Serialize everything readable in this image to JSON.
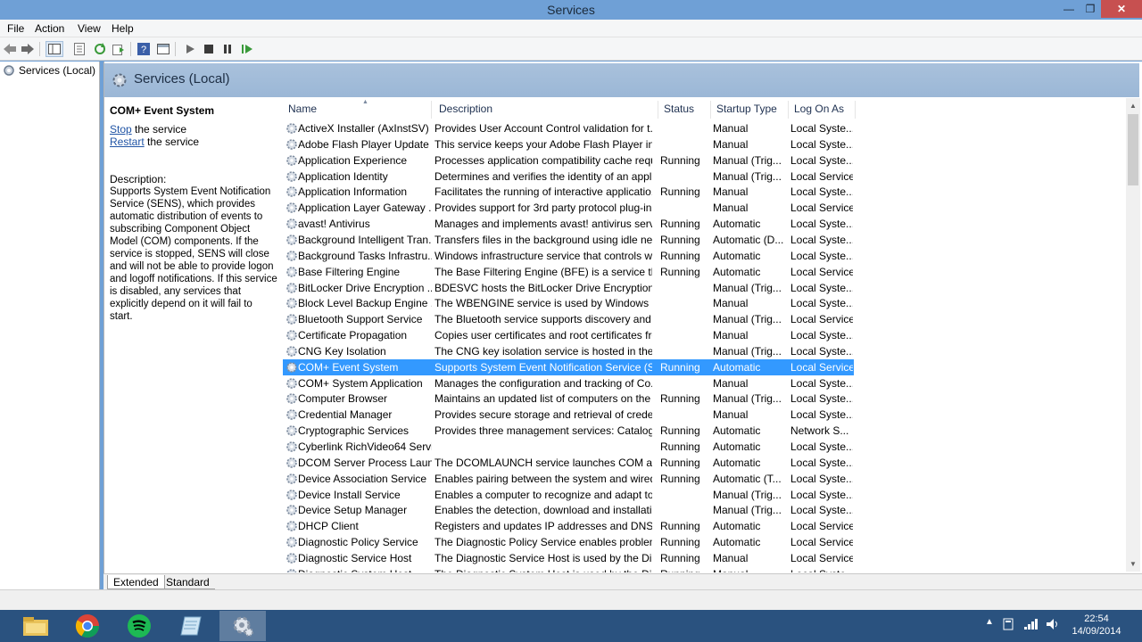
{
  "window": {
    "title": "Services",
    "controls": {
      "minimize": "—",
      "maximize": "❐",
      "close": "✕"
    }
  },
  "menu": [
    "File",
    "Action",
    "View",
    "Help"
  ],
  "toolbar": {
    "icons": [
      "back-icon",
      "forward-icon",
      "show-hide-tree-icon",
      "properties-icon",
      "refresh-icon",
      "export-list-icon",
      "help-icon",
      "view-icon",
      "play-icon",
      "stop-icon",
      "pause-icon",
      "resume-icon"
    ]
  },
  "tree": {
    "root": "Services (Local)"
  },
  "banner": {
    "title": "Services (Local)"
  },
  "details": {
    "service_title": "COM+ Event System",
    "stop_link": "Stop",
    "stop_suffix": " the service",
    "restart_link": "Restart",
    "restart_suffix": " the service",
    "description_label": "Description:",
    "description": "Supports System Event Notification Service (SENS), which provides automatic distribution of events to subscribing Component Object Model (COM) components. If the service is stopped, SENS will close and will not be able to provide logon and logoff notifications. If this service is disabled, any services that explicitly depend on it will fail to start."
  },
  "table": {
    "columns": [
      "Name",
      "Description",
      "Status",
      "Startup Type",
      "Log On As"
    ],
    "sort_indicator": "▲",
    "selected_index": 15,
    "rows": [
      [
        "ActiveX Installer (AxInstSV)",
        "Provides User Account Control validation for t...",
        "",
        "Manual",
        "Local Syste..."
      ],
      [
        "Adobe Flash Player Update ...",
        "This service keeps your Adobe Flash Player inst...",
        "",
        "Manual",
        "Local Syste..."
      ],
      [
        "Application Experience",
        "Processes application compatibility cache requ...",
        "Running",
        "Manual (Trig...",
        "Local Syste..."
      ],
      [
        "Application Identity",
        "Determines and verifies the identity of an appli...",
        "",
        "Manual (Trig...",
        "Local Service"
      ],
      [
        "Application Information",
        "Facilitates the running of interactive applicatio...",
        "Running",
        "Manual",
        "Local Syste..."
      ],
      [
        "Application Layer Gateway ...",
        "Provides support for 3rd party protocol plug-in...",
        "",
        "Manual",
        "Local Service"
      ],
      [
        "avast! Antivirus",
        "Manages and implements avast! antivirus servi...",
        "Running",
        "Automatic",
        "Local Syste..."
      ],
      [
        "Background Intelligent Tran...",
        "Transfers files in the background using idle net...",
        "Running",
        "Automatic (D...",
        "Local Syste..."
      ],
      [
        "Background Tasks Infrastru...",
        "Windows infrastructure service that controls w...",
        "Running",
        "Automatic",
        "Local Syste..."
      ],
      [
        "Base Filtering Engine",
        "The Base Filtering Engine (BFE) is a service that ...",
        "Running",
        "Automatic",
        "Local Service"
      ],
      [
        "BitLocker Drive Encryption ...",
        "BDESVC hosts the BitLocker Drive Encryption s...",
        "",
        "Manual (Trig...",
        "Local Syste..."
      ],
      [
        "Block Level Backup Engine ...",
        "The WBENGINE service is used by Windows Ba...",
        "",
        "Manual",
        "Local Syste..."
      ],
      [
        "Bluetooth Support Service",
        "The Bluetooth service supports discovery and a...",
        "",
        "Manual (Trig...",
        "Local Service"
      ],
      [
        "Certificate Propagation",
        "Copies user certificates and root certificates fro...",
        "",
        "Manual",
        "Local Syste..."
      ],
      [
        "CNG Key Isolation",
        "The CNG key isolation service is hosted in the L...",
        "",
        "Manual (Trig...",
        "Local Syste..."
      ],
      [
        "COM+ Event System",
        "Supports System Event Notification Service (SE...",
        "Running",
        "Automatic",
        "Local Service"
      ],
      [
        "COM+ System Application",
        "Manages the configuration and tracking of Co...",
        "",
        "Manual",
        "Local Syste..."
      ],
      [
        "Computer Browser",
        "Maintains an updated list of computers on the ...",
        "Running",
        "Manual (Trig...",
        "Local Syste..."
      ],
      [
        "Credential Manager",
        "Provides secure storage and retrieval of creden...",
        "",
        "Manual",
        "Local Syste..."
      ],
      [
        "Cryptographic Services",
        "Provides three management services: Catalog ...",
        "Running",
        "Automatic",
        "Network S..."
      ],
      [
        "Cyberlink RichVideo64 Servi...",
        "",
        "Running",
        "Automatic",
        "Local Syste..."
      ],
      [
        "DCOM Server Process Laun...",
        "The DCOMLAUNCH service launches COM an...",
        "Running",
        "Automatic",
        "Local Syste..."
      ],
      [
        "Device Association Service",
        "Enables pairing between the system and wired ...",
        "Running",
        "Automatic (T...",
        "Local Syste..."
      ],
      [
        "Device Install Service",
        "Enables a computer to recognize and adapt to ...",
        "",
        "Manual (Trig...",
        "Local Syste..."
      ],
      [
        "Device Setup Manager",
        "Enables the detection, download and installati...",
        "",
        "Manual (Trig...",
        "Local Syste..."
      ],
      [
        "DHCP Client",
        "Registers and updates IP addresses and DNS re...",
        "Running",
        "Automatic",
        "Local Service"
      ],
      [
        "Diagnostic Policy Service",
        "The Diagnostic Policy Service enables problem ...",
        "Running",
        "Automatic",
        "Local Service"
      ],
      [
        "Diagnostic Service Host",
        "The Diagnostic Service Host is used by the Dia...",
        "Running",
        "Manual",
        "Local Service"
      ],
      [
        "Diagnostic System Host",
        "The Diagnostic System Host is used by the Dia...",
        "Running",
        "Manual",
        "Local Syste..."
      ]
    ]
  },
  "tabs": [
    "Extended",
    "Standard"
  ],
  "taskbar": {
    "apps": [
      "file-explorer-icon",
      "chrome-icon",
      "spotify-icon",
      "notepad-icon",
      "services-gear-icon"
    ],
    "active_app": "services-gear-icon",
    "tray_arrow": "▲",
    "clock_time": "22:54",
    "clock_date": "14/09/2014"
  },
  "colors": {
    "titlebar": "#6fa0d6",
    "selection": "#3399ff",
    "taskbar": "#2a527f",
    "close_button": "#c75050"
  }
}
